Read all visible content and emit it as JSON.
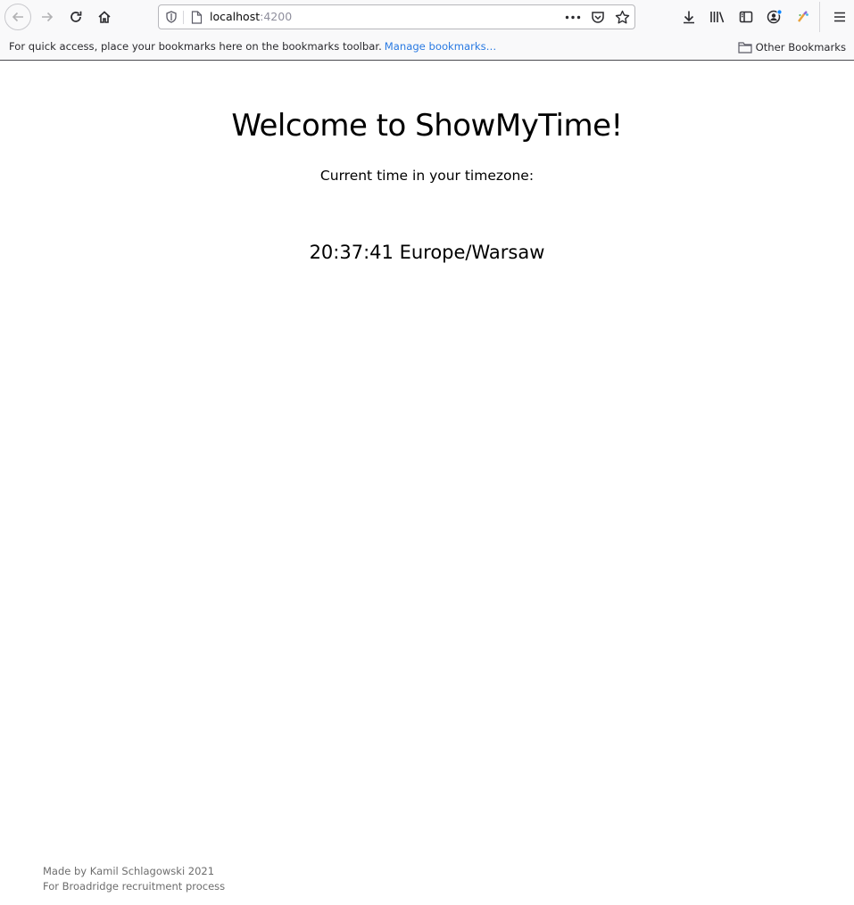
{
  "browser": {
    "url_host": "localhost",
    "url_port": ":4200",
    "icons": [
      "back-icon",
      "forward-icon",
      "reload-icon",
      "home-icon",
      "shield-icon",
      "page-icon",
      "more-icon",
      "pocket-icon",
      "star-icon",
      "download-icon",
      "library-icon",
      "sidebar-icon",
      "account-icon",
      "extension-icon",
      "menu-icon"
    ]
  },
  "bookmarks_bar": {
    "message": "For quick access, place your bookmarks here on the bookmarks toolbar.",
    "manage_link": "Manage bookmarks…",
    "other_bookmarks": "Other Bookmarks"
  },
  "page": {
    "title": "Welcome to ShowMyTime!",
    "subtitle": "Current time in your timezone:",
    "time": "20:37:41",
    "timezone": "Europe/Warsaw"
  },
  "footer": {
    "line1": "Made by Kamil Schlagowski 2021",
    "line2": "For Broadridge recruitment process"
  }
}
